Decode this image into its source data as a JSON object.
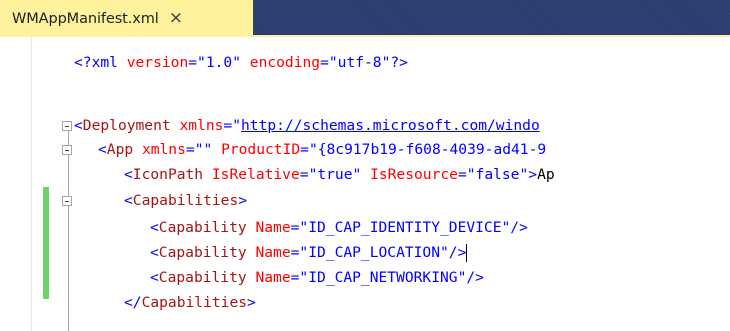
{
  "tab": {
    "title": "WMAppManifest.xml",
    "close_glyph": "×",
    "icon": "close-icon"
  },
  "code": {
    "xml_decl": {
      "open": "<?xml",
      "attr1": "version",
      "val1": "\"1.0\"",
      "attr2": "encoding",
      "val2": "\"utf-8\"",
      "close": "?>"
    },
    "deployment": {
      "open": "<",
      "tag": "Deployment",
      "attr": "xmlns",
      "eq": "=",
      "quote_open": "\"",
      "url": "http://schemas.microsoft.com/windo"
    },
    "app": {
      "open": "<",
      "tag": "App",
      "attr1": "xmlns",
      "eq1": "=",
      "val1": "\"\"",
      "attr2": "ProductID",
      "eq2": "=",
      "val2": "\"{8c917b19-f608-4039-ad41-9"
    },
    "iconpath": {
      "open": "<",
      "tag": "IconPath",
      "attr1": "IsRelative",
      "eq1": "=",
      "val1": "\"true\"",
      "attr2": "IsResource",
      "eq2": "=",
      "val2": "\"false\"",
      "close": ">",
      "text": "Ap"
    },
    "capabilities_open": {
      "open": "<",
      "tag": "Capabilities",
      "close": ">"
    },
    "capability_lines": [
      {
        "open": "<",
        "tag": "Capability",
        "attr": "Name",
        "eq": "=",
        "value": "\"ID_CAP_IDENTITY_DEVICE\"",
        "close": "/>"
      },
      {
        "open": "<",
        "tag": "Capability",
        "attr": "Name",
        "eq": "=",
        "value": "\"ID_CAP_LOCATION\"",
        "close": "/>"
      },
      {
        "open": "<",
        "tag": "Capability",
        "attr": "Name",
        "eq": "=",
        "value": "\"ID_CAP_NETWORKING\"",
        "close": "/>"
      }
    ],
    "capabilities_close": {
      "open": "</",
      "tag": "Capabilities",
      "close": ">"
    }
  },
  "colors": {
    "tab_background": "#fff29d",
    "tabstrip_background": "#2b3c6e",
    "xml_delimiter": "#0000ff",
    "xml_tag": "#a31515",
    "xml_attribute": "#ff0000",
    "change_marker": "#6bd466"
  }
}
